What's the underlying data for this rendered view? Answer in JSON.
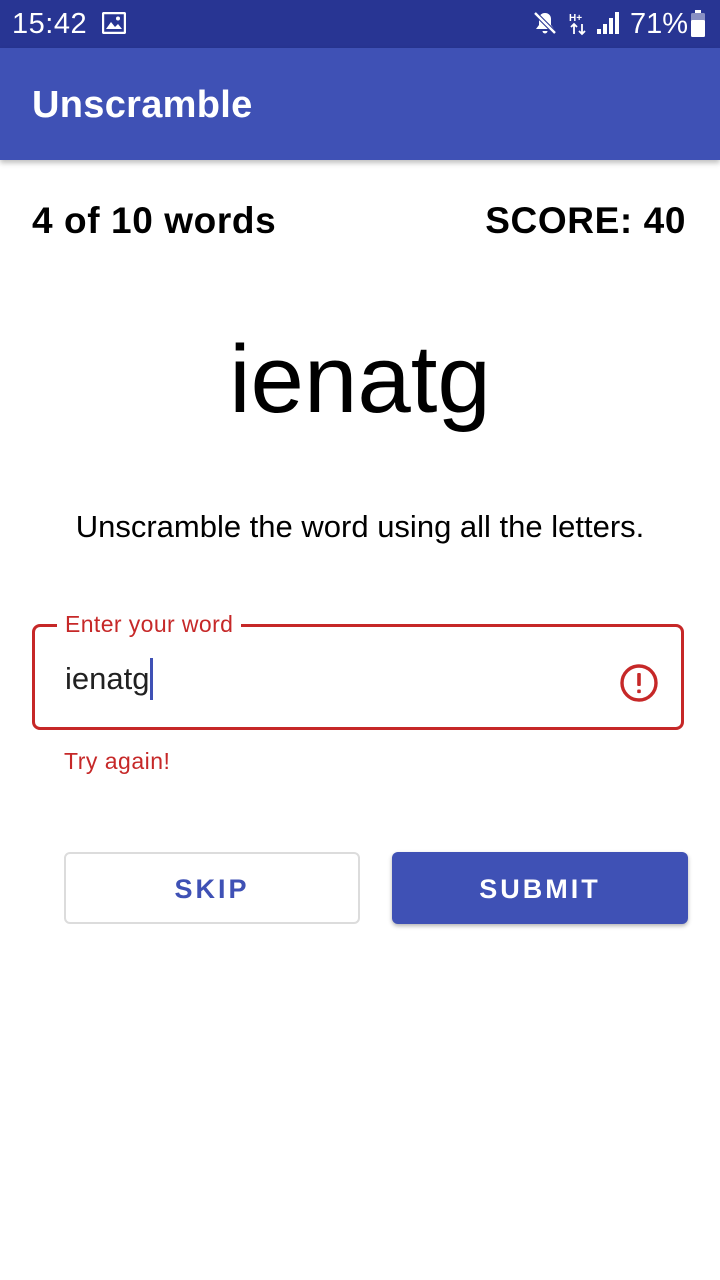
{
  "status_bar": {
    "time": "15:42",
    "battery_percent": "71%",
    "icons": [
      "gallery-icon",
      "mute-icon",
      "network-hplus-icon",
      "signal-icon",
      "battery-icon"
    ]
  },
  "app_bar": {
    "title": "Unscramble"
  },
  "game": {
    "word_count": "4 of 10 words",
    "score": "SCORE: 40",
    "scrambled_word": "ienatg",
    "instructions": "Unscramble the word using all the letters."
  },
  "input": {
    "label": "Enter your word",
    "value": "ienatg",
    "error_text": "Try again!",
    "error_icon": "error-icon"
  },
  "actions": {
    "skip_label": "SKIP",
    "submit_label": "SUBMIT"
  },
  "colors": {
    "status_bar": "#283593",
    "primary": "#3f51b5",
    "error": "#c62828",
    "text": "#000000",
    "background": "#ffffff"
  }
}
